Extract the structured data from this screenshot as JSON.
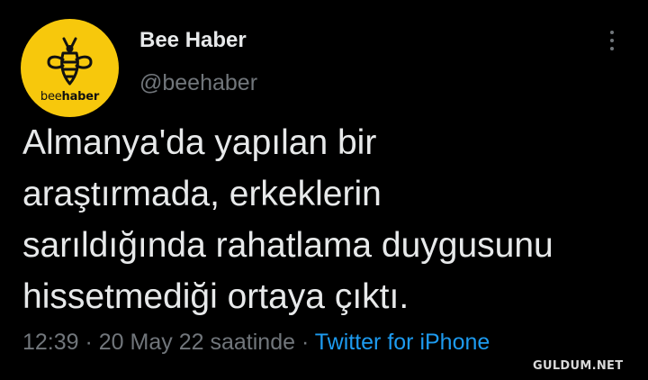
{
  "account": {
    "name": "Bee Haber",
    "handle": "@beehaber",
    "avatar_logo_text_regular": "bee",
    "avatar_logo_text_bold": "haber",
    "avatar_bg": "#f7c80c"
  },
  "tweet": {
    "text": "Almanya'da yapılan bir\naraştırmada, erkeklerin\nsarıldığında rahatlama duygusunu\nhissetmediği ortaya çıktı.",
    "time": "12:39",
    "sep1": " · ",
    "date": "20 May 22",
    "date_suffix": " saatinde",
    "sep2": " · ",
    "source": "Twitter for iPhone"
  },
  "icons": {
    "more": "more-vertical-icon",
    "bee": "bee-icon"
  },
  "colors": {
    "background": "#000000",
    "text": "#e7e9ea",
    "muted": "#71767b",
    "link": "#1d9bf0"
  },
  "watermark": "GULDUM.NET"
}
